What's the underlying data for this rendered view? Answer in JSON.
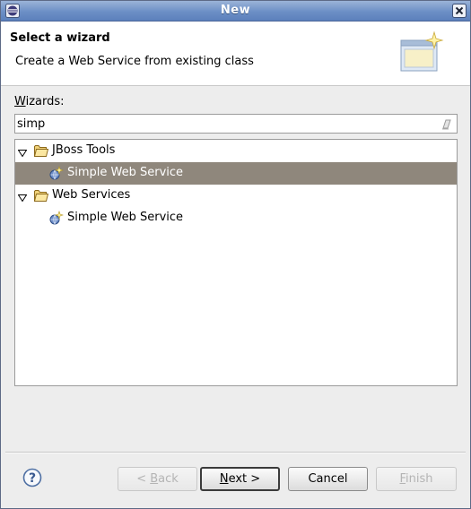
{
  "window": {
    "title": "New"
  },
  "banner": {
    "title": "Select a wizard",
    "description": "Create a Web Service from existing class"
  },
  "wizards": {
    "label_mnemonic": "W",
    "label_rest": "izards:",
    "filter_value": "simp"
  },
  "tree": {
    "groups": [
      {
        "label": "JBoss Tools",
        "expanded": true,
        "children": [
          {
            "label": "Simple Web Service",
            "selected": true
          }
        ]
      },
      {
        "label": "Web Services",
        "expanded": true,
        "children": [
          {
            "label": "Simple Web Service",
            "selected": false
          }
        ]
      }
    ]
  },
  "buttons": {
    "back": {
      "prefix": "< ",
      "mnemonic": "B",
      "rest": "ack",
      "enabled": false
    },
    "next": {
      "mnemonic": "N",
      "rest": "ext >",
      "enabled": true
    },
    "cancel": {
      "label": "Cancel",
      "enabled": true
    },
    "finish": {
      "mnemonic": "F",
      "rest": "inish",
      "enabled": false
    }
  },
  "colors": {
    "titlebar": "#6c8fc6",
    "selection": "#8f877c",
    "background": "#ededed"
  },
  "icons": {
    "app": "eclipse-icon",
    "close": "close-icon",
    "banner": "new-wizard-icon",
    "folder": "folder-icon",
    "web_service": "web-service-wizard-icon",
    "help": "help-icon",
    "clear": "clear-filter-icon"
  }
}
